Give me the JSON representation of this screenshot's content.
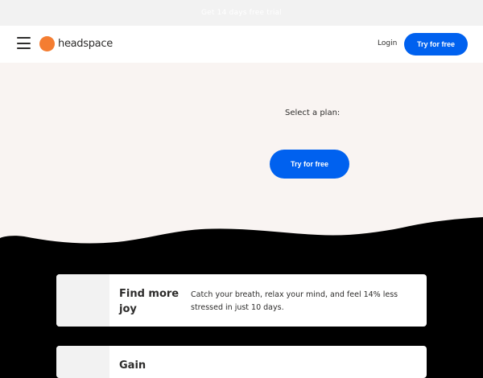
{
  "promo": {
    "text": "Get 14 days free trial"
  },
  "header": {
    "logo_text": "headspace",
    "login_label": "Login",
    "cta_label": "Try for free"
  },
  "hero": {
    "plan_label": "Select a plan:",
    "cta_label": "Try for free"
  },
  "benefits": [
    {
      "title": "Find more joy",
      "description": "Catch your breath, relax your mind, and feel 14% less stressed in just 10 days."
    },
    {
      "title": "Gain",
      "description": ""
    }
  ],
  "colors": {
    "accent": "#0061ef",
    "logo_orange": "#f47d31",
    "hero_background": "#f9f4f2",
    "page_background": "#000000"
  },
  "icons": {
    "menu": "hamburger-icon",
    "logo": "headspace-dot-logo"
  }
}
